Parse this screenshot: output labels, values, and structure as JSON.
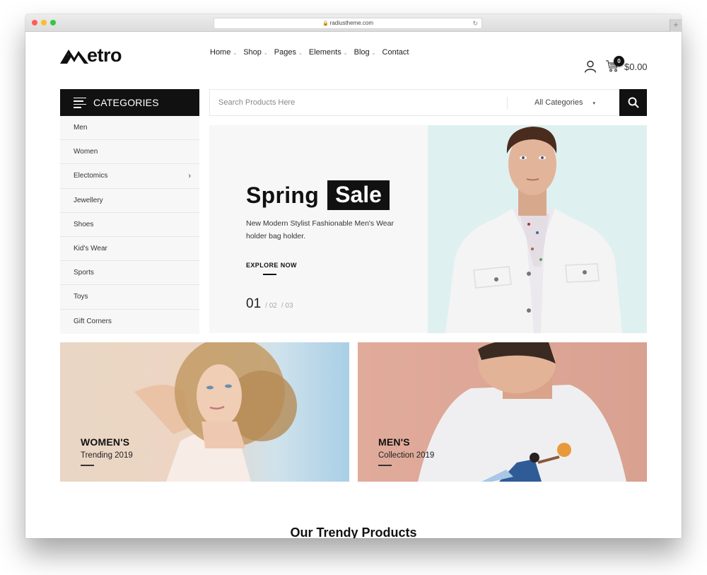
{
  "browser": {
    "url": "radiustheme.com"
  },
  "header": {
    "logo_text": "etro",
    "logo_alt": "Metro",
    "nav": [
      {
        "label": "Home",
        "has_dropdown": true
      },
      {
        "label": "Shop",
        "has_dropdown": true
      },
      {
        "label": "Pages",
        "has_dropdown": true
      },
      {
        "label": "Elements",
        "has_dropdown": true
      },
      {
        "label": "Blog",
        "has_dropdown": true
      },
      {
        "label": "Contact",
        "has_dropdown": false
      }
    ],
    "dropdown_caret": "⌄",
    "cart_count": "0",
    "cart_total": "$0.00"
  },
  "categories": {
    "title": "CATEGORIES",
    "items": [
      {
        "label": "Men"
      },
      {
        "label": "Women"
      },
      {
        "label": "Electomics",
        "has_submenu": true
      },
      {
        "label": "Jewellery"
      },
      {
        "label": "Shoes"
      },
      {
        "label": "Kid's Wear"
      },
      {
        "label": "Sports"
      },
      {
        "label": "Toys"
      },
      {
        "label": "Gift Corners"
      }
    ],
    "submenu_glyph": "›"
  },
  "search": {
    "placeholder": "Search Products Here",
    "value": "",
    "category_selected": "All Categories",
    "select_caret": "▾"
  },
  "hero": {
    "title_word1": "Spring",
    "title_word2": "Sale",
    "description": "New Modern Stylist Fashionable Men's Wear holder bag holder.",
    "cta": "EXPLORE NOW",
    "slide_current": "01",
    "slides_other": [
      "/ 02",
      "/ 03"
    ],
    "image_bg": "#dff0f0"
  },
  "promos": [
    {
      "title": "WOMEN'S",
      "subtitle": "Trending 2019"
    },
    {
      "title": "MEN'S",
      "subtitle": "Collection 2019"
    }
  ],
  "sections": {
    "trendy_title": "Our Trendy Products"
  },
  "colors": {
    "primary": "#111111",
    "sidebar_bg": "#f7f7f7",
    "hero_bg": "#f7f7f7"
  }
}
